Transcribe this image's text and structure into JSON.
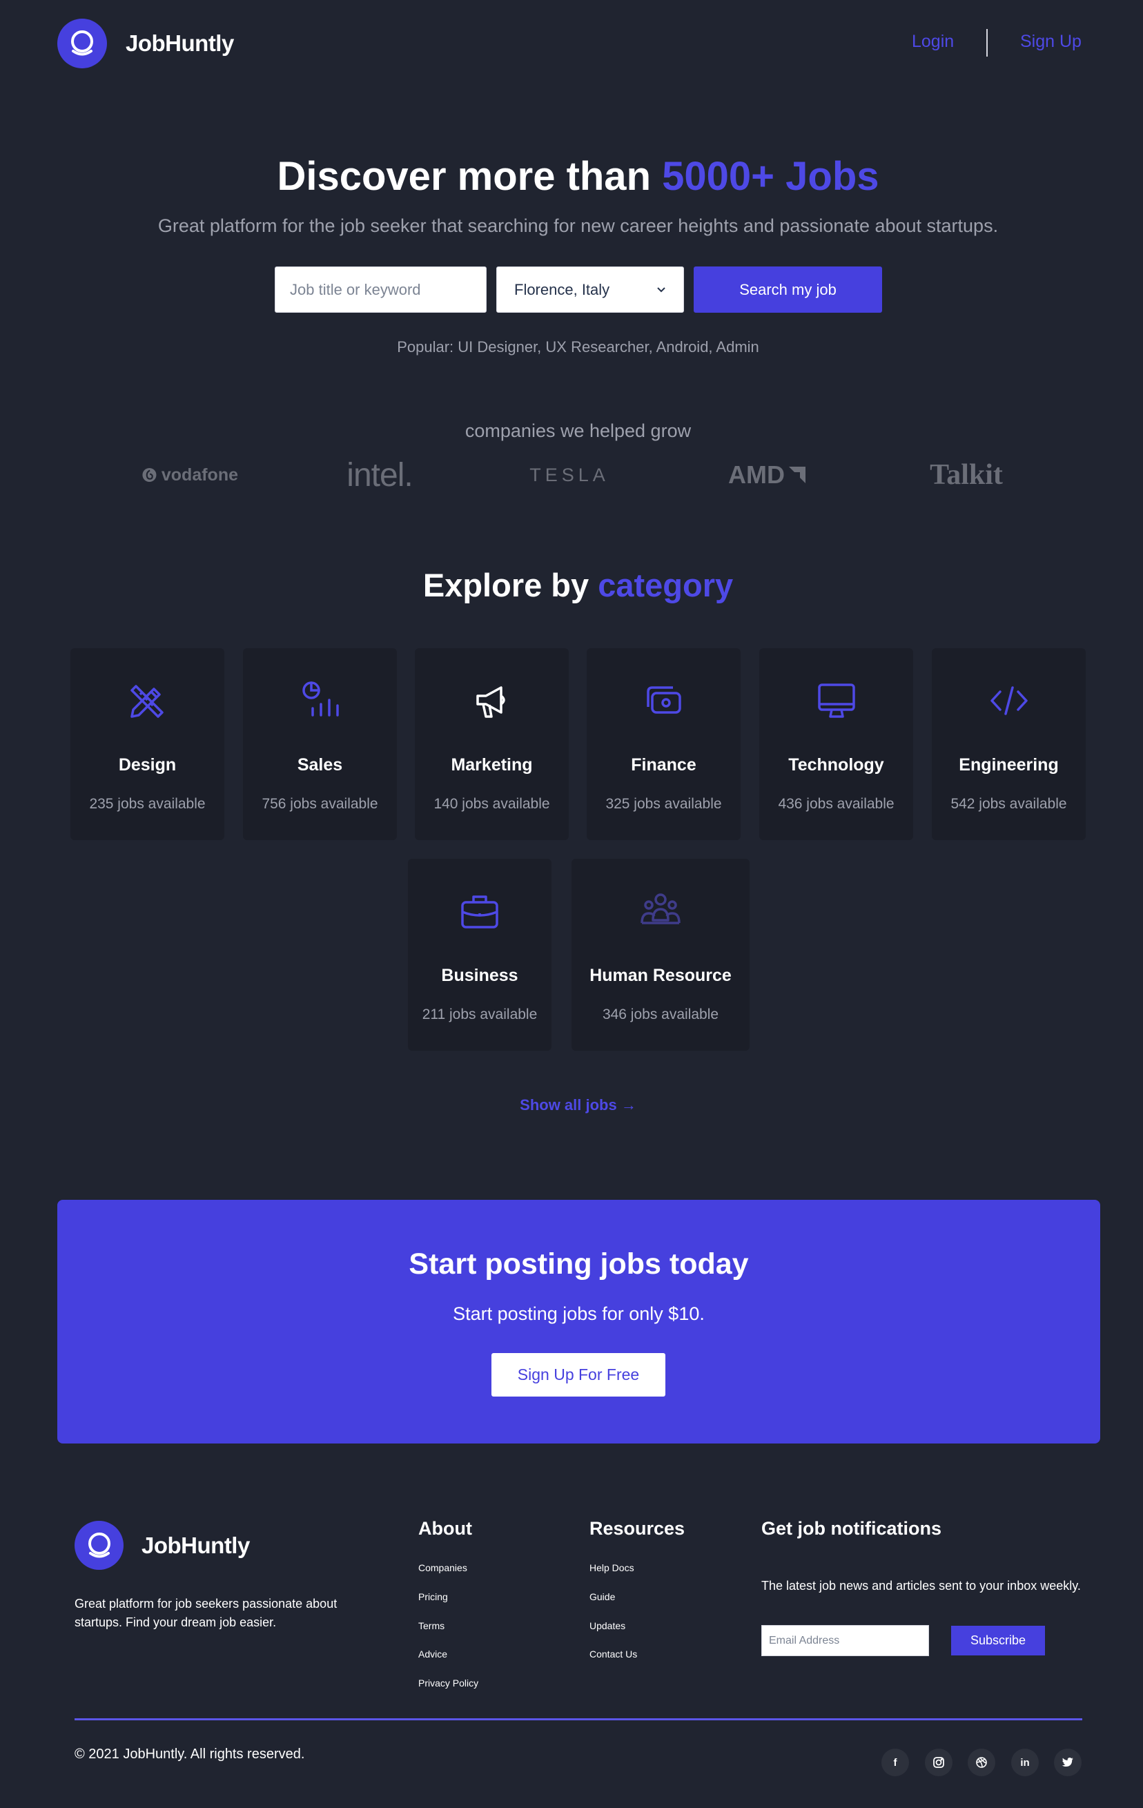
{
  "brand": {
    "name": "JobHuntly",
    "accent": "#4640de"
  },
  "nav": {
    "login": "Login",
    "signup": "Sign Up"
  },
  "hero": {
    "title_prefix": "Discover more than ",
    "title_accent": "5000+ Jobs",
    "subtitle": "Great platform for the job seeker that searching for new career heights and passionate about startups.",
    "search_placeholder": "Job title or keyword",
    "location": "Florence, Italy",
    "search_button": "Search my job",
    "popular": "Popular: UI Designer, UX Researcher, Android, Admin"
  },
  "companies": {
    "title": "companies we helped grow",
    "logos": [
      "vodafone",
      "intel.",
      "TESLA",
      "AMD",
      "Talkit"
    ]
  },
  "explore": {
    "title_prefix": "Explore by ",
    "title_accent": "category",
    "categories": [
      {
        "name": "Design",
        "count": "235 jobs available",
        "icon": "pencil-ruler-icon"
      },
      {
        "name": "Sales",
        "count": "756 jobs available",
        "icon": "chart-icon"
      },
      {
        "name": "Marketing",
        "count": "140 jobs available",
        "icon": "megaphone-icon"
      },
      {
        "name": "Finance",
        "count": "325 jobs available",
        "icon": "wallet-icon"
      },
      {
        "name": "Technology",
        "count": "436 jobs available",
        "icon": "monitor-icon"
      },
      {
        "name": "Engineering",
        "count": "542 jobs available",
        "icon": "code-icon"
      },
      {
        "name": "Business",
        "count": "211 jobs available",
        "icon": "briefcase-icon"
      },
      {
        "name": "Human Resource",
        "count": "346 jobs available",
        "icon": "people-icon"
      }
    ],
    "show_all": "Show all jobs →"
  },
  "cta": {
    "title": "Start posting jobs today",
    "subtitle": "Start posting jobs for only $10.",
    "button": "Sign Up For Free"
  },
  "footer": {
    "description": "Great platform for job seekers passionate about startups. Find your dream job easier.",
    "about_title": "About",
    "about_links": [
      "Companies",
      "Pricing",
      "Terms",
      "Advice",
      "Privacy Policy"
    ],
    "resources_title": "Resources",
    "resources_links": [
      "Help Docs",
      "Guide",
      "Updates",
      "Contact Us"
    ],
    "notif_title": "Get job notifications",
    "notif_text": "The latest job news and articles sent to your inbox weekly.",
    "email_placeholder": "Email Address",
    "subscribe": "Subscribe",
    "copyright": "© 2021 JobHuntly. All rights reserved.",
    "social": [
      "f",
      "in"
    ]
  }
}
